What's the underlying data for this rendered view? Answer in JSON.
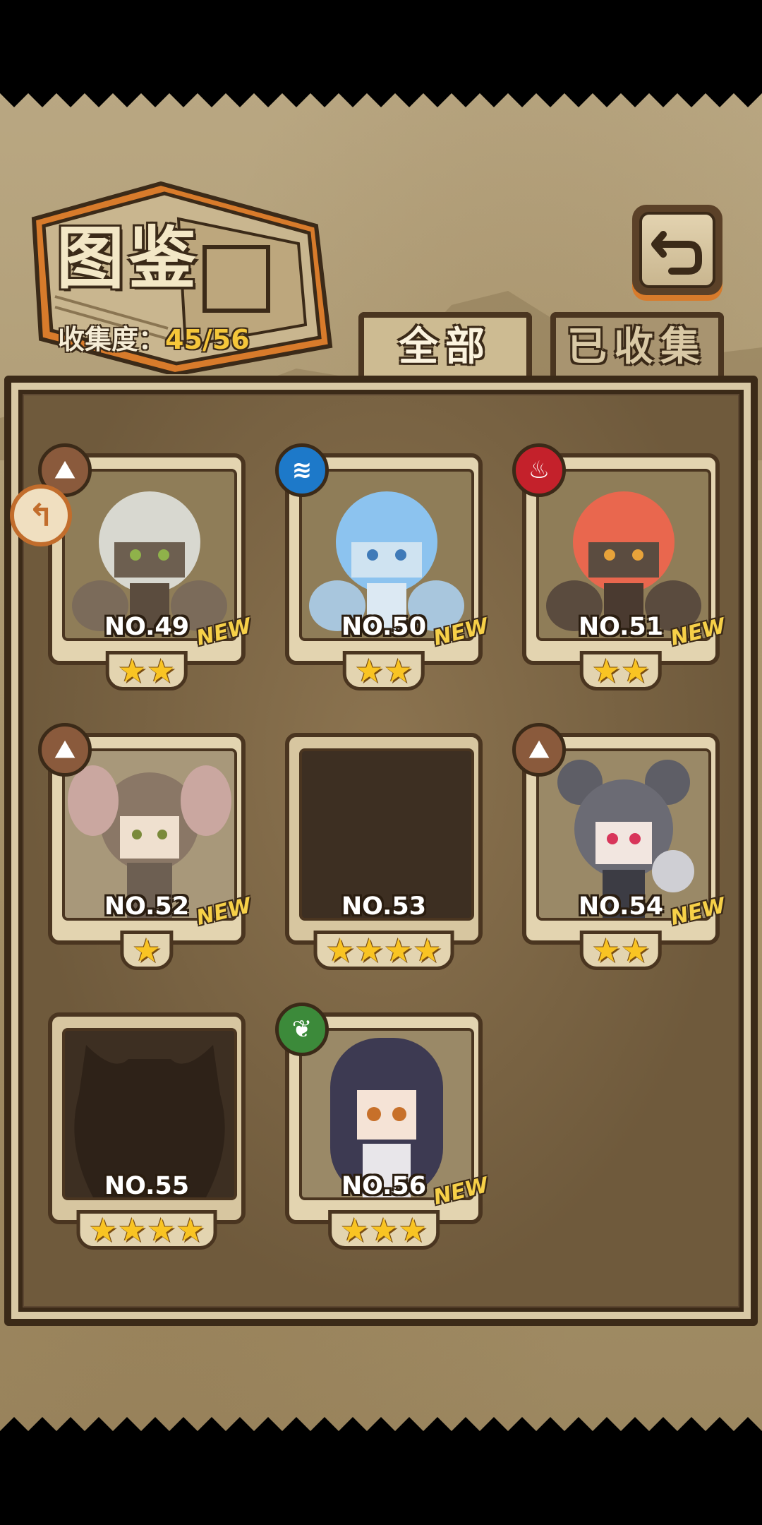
{
  "header": {
    "title": "图鉴",
    "collect_label": "收集度：",
    "collect_value": "45/56",
    "back_icon": "return-arrow-icon"
  },
  "tabs": [
    {
      "label": "全部",
      "active": true
    },
    {
      "label": "已收集",
      "active": false
    }
  ],
  "colors": {
    "parchment": "#a8946b",
    "frame": "#4a3520",
    "star": "#f9c423",
    "new_badge": "#f6d048",
    "accent_orange": "#d87b2b"
  },
  "cards": [
    {
      "number": "NO.49",
      "stars": "★★",
      "star_count": 2,
      "new": "NEW",
      "element": "earth",
      "element_icon": "mountain-icon",
      "locked": false
    },
    {
      "number": "NO.50",
      "stars": "★★",
      "star_count": 2,
      "new": "NEW",
      "element": "water",
      "element_icon": "water-icon",
      "locked": false
    },
    {
      "number": "NO.51",
      "stars": "★★",
      "star_count": 2,
      "new": "NEW",
      "element": "fire",
      "element_icon": "flame-icon",
      "locked": false
    },
    {
      "number": "NO.52",
      "stars": "★",
      "star_count": 1,
      "new": "NEW",
      "element": "earth",
      "element_icon": "mountain-icon",
      "locked": false
    },
    {
      "number": "NO.53",
      "stars": "★★★★",
      "star_count": 4,
      "new": "",
      "element": "",
      "element_icon": "",
      "locked": true
    },
    {
      "number": "NO.54",
      "stars": "★★",
      "star_count": 2,
      "new": "NEW",
      "element": "earth",
      "element_icon": "mountain-icon",
      "locked": false
    },
    {
      "number": "NO.55",
      "stars": "★★★★",
      "star_count": 4,
      "new": "",
      "element": "",
      "element_icon": "",
      "locked": true
    },
    {
      "number": "NO.56",
      "stars": "★★★",
      "star_count": 3,
      "new": "NEW",
      "element": "grass",
      "element_icon": "leaf-icon",
      "locked": false
    }
  ]
}
